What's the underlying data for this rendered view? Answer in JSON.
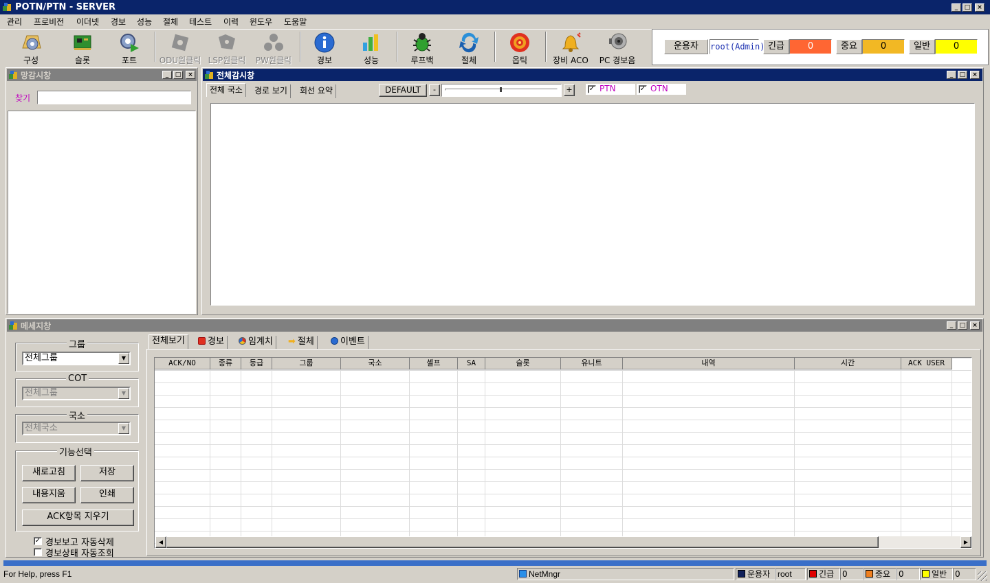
{
  "app": {
    "title": "POTN/PTN - SERVER"
  },
  "menu": [
    "관리",
    "프로비전",
    "이더넷",
    "경보",
    "성능",
    "절체",
    "테스트",
    "이력",
    "윈도우",
    "도움말"
  ],
  "toolbar": {
    "config": "구성",
    "slot": "슬롯",
    "port": "포트",
    "odu": "ODU원클릭",
    "lsp": "LSP원클릭",
    "pw": "PW원클릭",
    "alarm": "경보",
    "perf": "성능",
    "loopback": "루프백",
    "switch": "절체",
    "optic": "옵틱",
    "aco": "장비 ACO",
    "pc_alarm": "PC 경보음"
  },
  "status_top": {
    "operator_label": "운용자",
    "operator_value": "root(Admin)",
    "urgent_label": "긴급",
    "urgent_value": "0",
    "major_label": "중요",
    "major_value": "0",
    "normal_label": "일반",
    "normal_value": "0",
    "colors": {
      "urgent": "#ff6633",
      "major": "#f2b824",
      "normal": "#ffff00"
    }
  },
  "net_panel": {
    "title": "망감시창",
    "search_label": "찾기",
    "search_value": ""
  },
  "main_panel": {
    "title": "전체감시창",
    "tabs": [
      "전체 국소",
      "경로 보기",
      "회선 요약"
    ],
    "default_btn": "DEFAULT",
    "minus": "-",
    "plus": "+",
    "check_ptn": "PTN",
    "check_otn": "OTN"
  },
  "msg_panel": {
    "title": "메세지창",
    "group_label": "그룹",
    "group_value": "전체그룹",
    "cot_label": "COT",
    "cot_value": "전체그룹",
    "site_label": "국소",
    "site_value": "전체국소",
    "func_label": "기능선택",
    "refresh": "새로고침",
    "save": "저장",
    "clear": "내용지움",
    "print": "인쇄",
    "ack_clear": "ACK항목 지우기",
    "auto_delete": "경보보고 자동삭제",
    "auto_query": "경보상태 자동조회",
    "tabs": [
      "전체보기",
      "경보",
      "임계치",
      "절체",
      "이벤트"
    ],
    "columns": [
      "ACK/NO",
      "종류",
      "등급",
      "그룹",
      "국소",
      "셸프",
      "SA",
      "슬롯",
      "유니트",
      "내역",
      "시간",
      "ACK USER"
    ]
  },
  "statusbar": {
    "help": "For Help, press F1",
    "mngr": "NetMngr",
    "operator_label": "운용자",
    "operator_value": "root",
    "urgent_label": "긴급",
    "urgent_value": "0",
    "major_label": "중요",
    "major_value": "0",
    "normal_label": "일반",
    "normal_value": "0"
  }
}
